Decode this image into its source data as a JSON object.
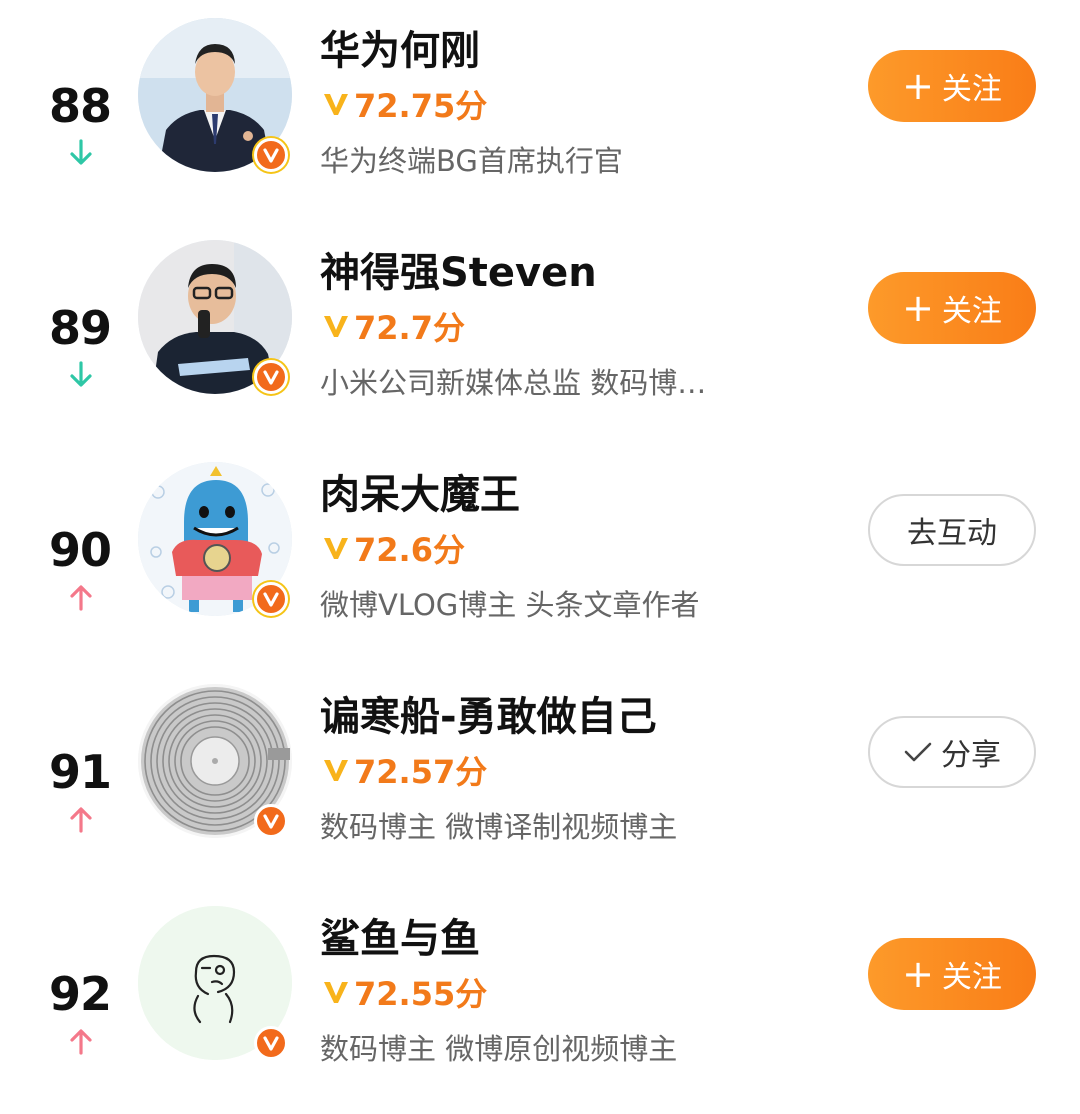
{
  "colors": {
    "accent_orange": "#f97d17",
    "trend_down": "#2ec7a6",
    "trend_up": "#f4788a",
    "score": "#f27a1a"
  },
  "entries": [
    {
      "rank": "88",
      "trend": "down",
      "trend_icon": "arrow-down-icon",
      "name": "华为何刚",
      "score": "72.75分",
      "desc": "华为终端BG首席执行官",
      "badge": "gold",
      "action": {
        "type": "follow",
        "plus": "+",
        "label": "关注"
      }
    },
    {
      "rank": "89",
      "trend": "down",
      "trend_icon": "arrow-down-icon",
      "name": "神得强Steven",
      "score": "72.7分",
      "desc": "小米公司新媒体总监 数码博…",
      "badge": "gold",
      "action": {
        "type": "follow",
        "plus": "+",
        "label": "关注"
      }
    },
    {
      "rank": "90",
      "trend": "up",
      "trend_icon": "arrow-up-icon",
      "name": "肉呆大魔王",
      "score": "72.6分",
      "desc": "微博VLOG博主 头条文章作者",
      "badge": "gold",
      "action": {
        "type": "interact",
        "label": "去互动"
      }
    },
    {
      "rank": "91",
      "trend": "up",
      "trend_icon": "arrow-up-icon",
      "name": "谝寒船-勇敢做自己",
      "score": "72.57分",
      "desc": "数码博主 微博译制视频博主",
      "badge": "orange",
      "action": {
        "type": "share",
        "label": "分享"
      }
    },
    {
      "rank": "92",
      "trend": "up",
      "trend_icon": "arrow-up-icon",
      "name": "鲨鱼与鱼",
      "score": "72.55分",
      "desc": "数码博主 微博原创视频博主",
      "badge": "orange",
      "action": {
        "type": "follow",
        "plus": "+",
        "label": "关注"
      }
    }
  ]
}
